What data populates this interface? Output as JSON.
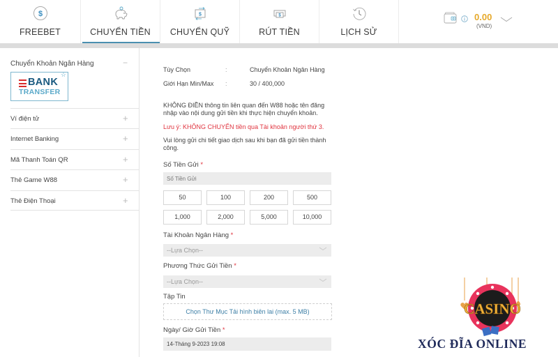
{
  "nav": {
    "tabs": [
      {
        "label": "FREEBET",
        "icon": "dollar-circle-icon",
        "active": false
      },
      {
        "label": "CHUYỂN TIỀN",
        "icon": "piggy-bank-icon",
        "active": true
      },
      {
        "label": "CHUYỂN QUỸ",
        "icon": "transfer-funds-icon",
        "active": false
      },
      {
        "label": "RÚT TIỀN",
        "icon": "withdraw-cash-icon",
        "active": false
      },
      {
        "label": "LỊCH SỬ",
        "icon": "history-clock-icon",
        "active": false
      }
    ],
    "wallet": {
      "balance": "0.00",
      "currency": "(VND)",
      "balance_color": "#e6a92b"
    }
  },
  "sidebar": {
    "expanded": {
      "label": "Chuyển Khoản Ngân Hàng",
      "toggle": "−",
      "logo": {
        "line1": "BANK",
        "line2": "TRANSFER"
      }
    },
    "items": [
      {
        "label": "Ví điện tử",
        "toggle": "+"
      },
      {
        "label": "Internet Banking",
        "toggle": "+"
      },
      {
        "label": "Mã Thanh Toán QR",
        "toggle": "+"
      },
      {
        "label": "Thẻ Game W88",
        "toggle": "+"
      },
      {
        "label": "Thẻ Điện Thoại",
        "toggle": "+"
      }
    ]
  },
  "form": {
    "info": [
      {
        "key": "Tùy Chọn",
        "sep": ":",
        "value": "Chuyển Khoản Ngân Hàng"
      },
      {
        "key": "Giới Hạn Min/Max",
        "sep": ":",
        "value": "30 / 400,000"
      }
    ],
    "notice1": "KHÔNG ĐIỀN thông tin liên quan đến W88 hoặc tên đăng nhập vào nội dung gửi tiền khi thực hiện chuyển khoản.",
    "notice_warning": "Lưu ý: KHÔNG CHUYỂN tiền qua Tài khoản người thứ 3.",
    "notice2": "Vui lòng gửi chi tiết giao dịch sau khi bạn đã gửi tiền thành công.",
    "amount": {
      "label": "Số Tiền Gửi",
      "required": "*",
      "placeholder": "Số Tiền Gửi",
      "value": "",
      "quick_amounts": [
        "50",
        "100",
        "200",
        "500",
        "1,000",
        "2,000",
        "5,000",
        "10,000"
      ]
    },
    "bank_account": {
      "label": "Tài Khoản Ngân Hàng",
      "required": "*",
      "selected": "--Lựa Chọn--"
    },
    "deposit_method": {
      "label": "Phương Thức Gửi Tiền",
      "required": "*",
      "selected": "--Lựa Chọn--"
    },
    "file": {
      "label": "Tập Tin",
      "button": "Chọn Thư Mục Tải hình biên lai (max. 5 MB)"
    },
    "datetime": {
      "label": "Ngày/ Giờ Gửi Tiền",
      "required": "*",
      "value": "14-Tháng 9-2023 19:08"
    }
  },
  "watermark": {
    "badge_text": "CASINO",
    "caption": "XÓC ĐĨA ONLINE"
  },
  "colors": {
    "accent": "#4a8fb0",
    "warning": "#e0343f",
    "link": "#3d7fa6"
  }
}
